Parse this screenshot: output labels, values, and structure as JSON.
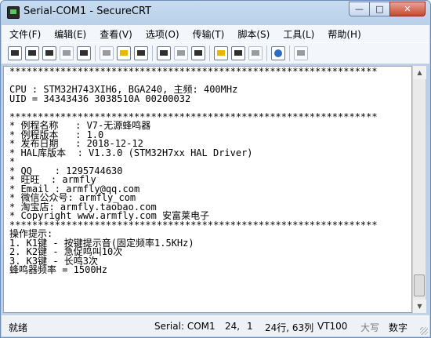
{
  "window": {
    "title": "Serial-COM1 - SecureCRT",
    "controls": {
      "minimize": "—",
      "maximize": "□",
      "close": "✕"
    }
  },
  "menu": [
    "文件(F)",
    "编辑(E)",
    "查看(V)",
    "选项(O)",
    "传输(T)",
    "脚本(S)",
    "工具(L)",
    "帮助(H)"
  ],
  "toolbar": {
    "icons": [
      "connect-icon",
      "quick-connect-icon",
      "connect-tab-icon",
      "reconnect-icon",
      "disconnect-icon",
      "copy-icon",
      "paste-icon",
      "find-icon",
      "print-setup-icon",
      "print-selection-icon",
      "print-icon",
      "session-options-icon",
      "global-options-icon",
      "keymap-icon",
      "help-icon",
      "sftp-icon"
    ]
  },
  "terminal": {
    "lines": [
      "*****************************************************************",
      "",
      "CPU : STM32H743XIH6, BGA240, 主频: 400MHz",
      "UID = 34343436 3038510A 00200032",
      "",
      "*****************************************************************",
      "* 例程名称   : V7-无源蜂鸣器",
      "* 例程版本   : 1.0",
      "* 发布日期   : 2018-12-12",
      "* HAL库版本  : V1.3.0 (STM32H7xx HAL Driver)",
      "*",
      "* QQ    : 1295744630",
      "* 旺旺  : armfly",
      "* Email : armfly@qq.com",
      "* 微信公众号: armfly_com",
      "* 淘宝店: armfly.taobao.com",
      "* Copyright www.armfly.com 安富莱电子",
      "*****************************************************************",
      "操作提示:",
      "1. K1键 - 按键提示音(固定频率1.5KHz)",
      "2. K2键 - 急促鸣叫10次",
      "3. K3键 - 长鸣3次",
      "蜂鸣器频率 = 1500Hz"
    ]
  },
  "status": {
    "ready": "就绪",
    "port": "Serial: COM1",
    "row": "24,",
    "col": "1",
    "position": "24行, 63列",
    "terminal_type": "VT100",
    "caps": "大写",
    "num": "数字"
  }
}
